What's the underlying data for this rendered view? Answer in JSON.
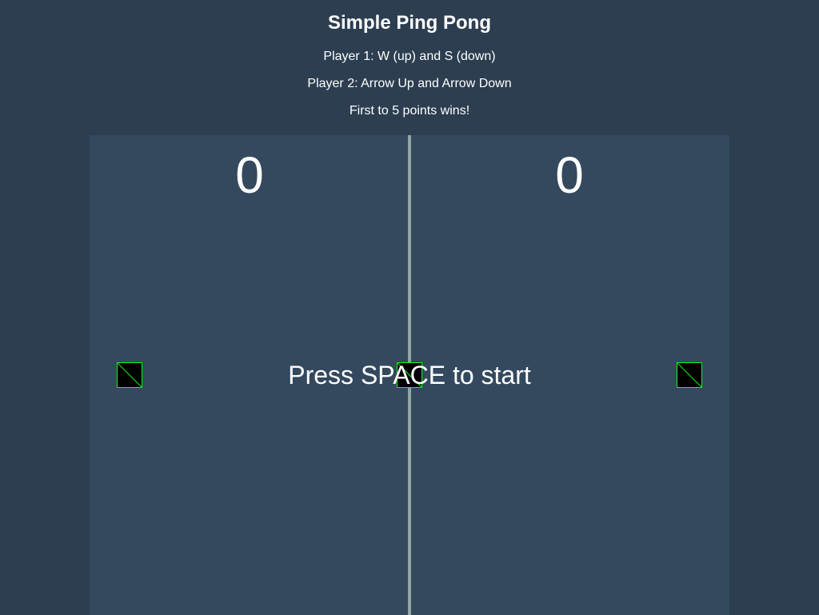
{
  "header": {
    "title": "Simple Ping Pong",
    "instructions": [
      "Player 1: W (up) and S (down)",
      "Player 2: Arrow Up and Arrow Down",
      "First to 5 points wins!"
    ]
  },
  "game": {
    "score_player1": "0",
    "score_player2": "0",
    "prompt": "Press SPACE to start"
  },
  "colors": {
    "page_background": "#2c3e50",
    "court_background": "#34495e",
    "net": "#95a5a6",
    "text": "#ffffff",
    "missing_sprite_border": "#00ff00"
  }
}
